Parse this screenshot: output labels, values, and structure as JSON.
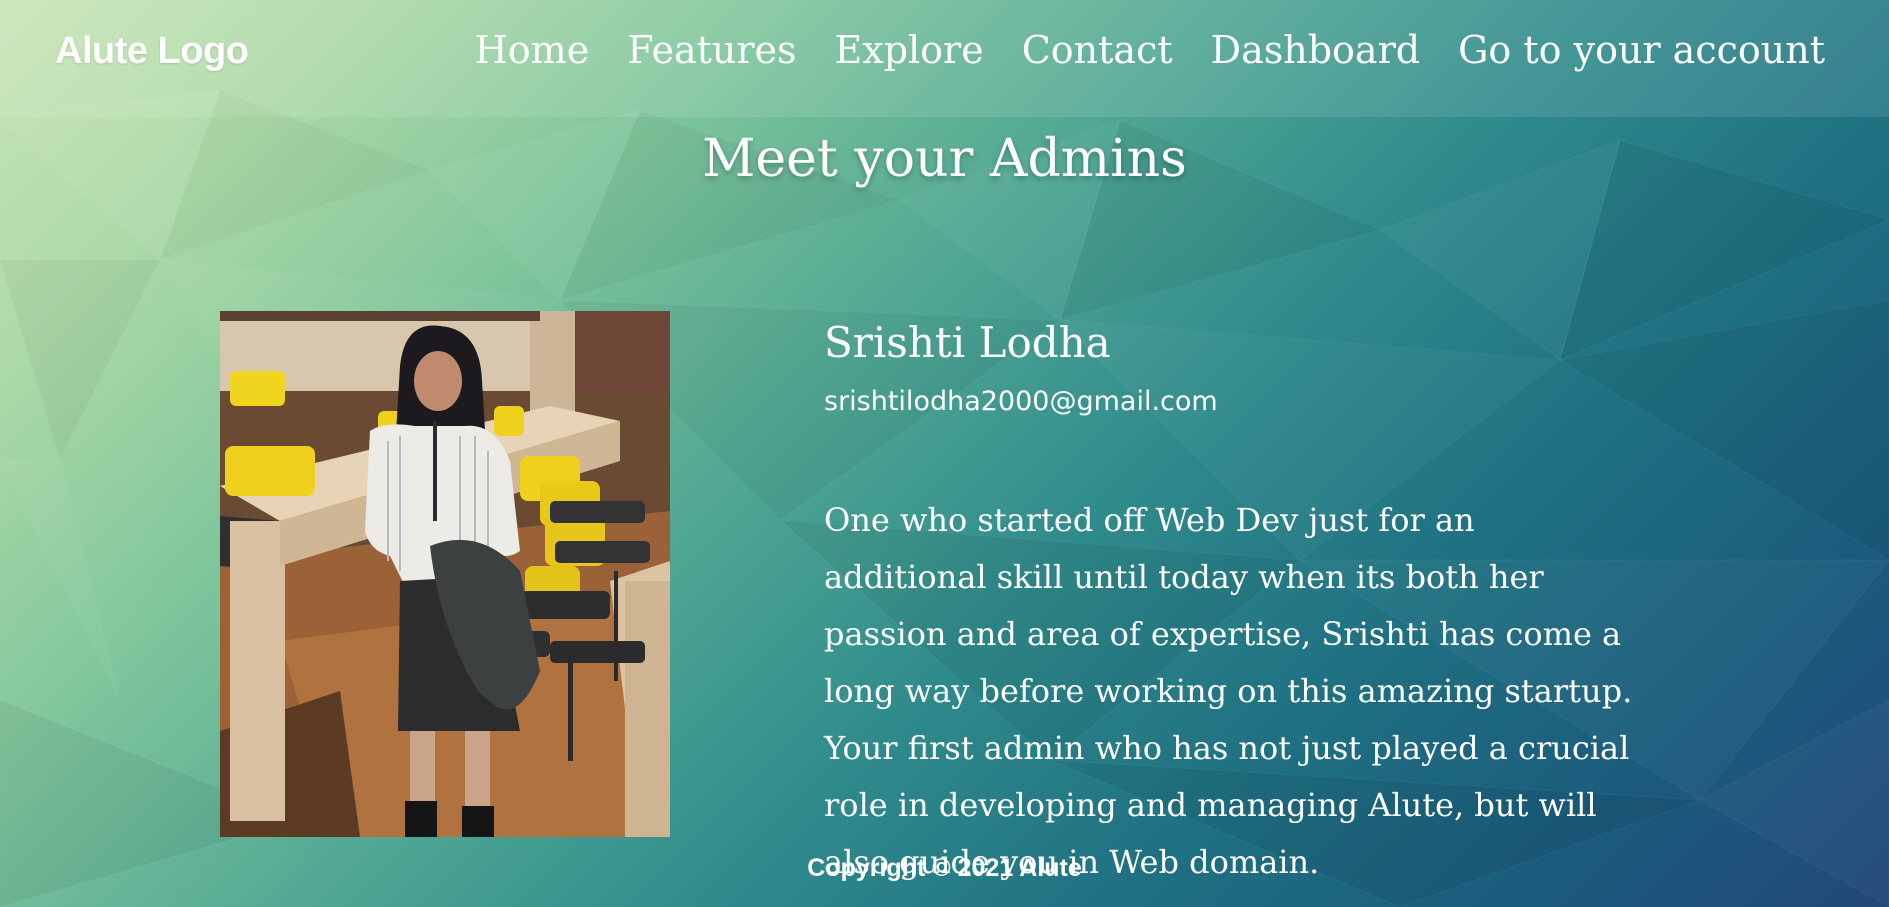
{
  "header": {
    "logo": "Alute Logo",
    "nav": [
      {
        "label": "Home"
      },
      {
        "label": "Features"
      },
      {
        "label": "Explore"
      },
      {
        "label": "Contact"
      },
      {
        "label": "Dashboard"
      },
      {
        "label": "Go to your account"
      }
    ]
  },
  "main": {
    "title": "Meet your Admins",
    "admin": {
      "name": "Srishti Lodha",
      "email": "srishtilodha2000@gmail.com",
      "bio": "One who started off Web Dev just for an additional skill until today when its both her passion and area of expertise, Srishti has come a long way before working on this amazing startup. Your first admin who has not just played a crucial role in developing and managing Alute, but will also guide you in Web domain."
    }
  },
  "footer": {
    "copyright": "Copyright © 2021 Alute"
  }
}
